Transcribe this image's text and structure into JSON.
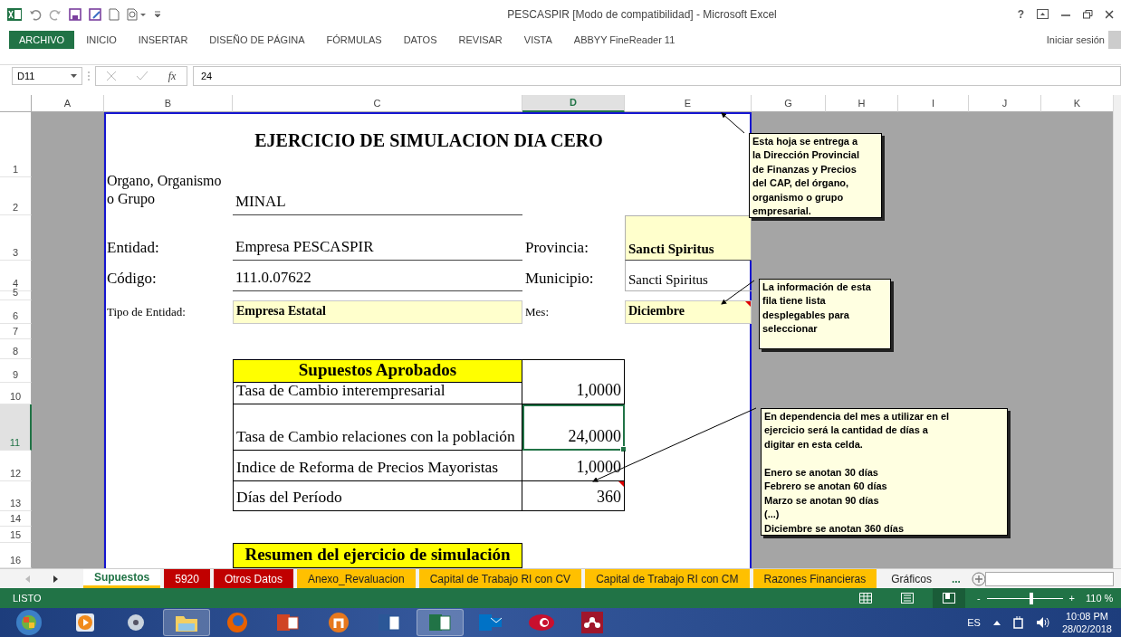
{
  "window": {
    "title": "PESCASPIR  [Modo de compatibilidad] - Microsoft Excel",
    "help": "?"
  },
  "ribbon": {
    "tabs": [
      {
        "label": "ARCHIVO",
        "selected": true
      },
      {
        "label": "INICIO",
        "selected": false
      },
      {
        "label": "INSERTAR",
        "selected": false
      },
      {
        "label": "DISEÑO DE PÁGINA",
        "selected": false
      },
      {
        "label": "FÓRMULAS",
        "selected": false
      },
      {
        "label": "DATOS",
        "selected": false
      },
      {
        "label": "REVISAR",
        "selected": false
      },
      {
        "label": "VISTA",
        "selected": false
      },
      {
        "label": "ABBYY FineReader 11",
        "selected": false
      }
    ],
    "sign_in": "Iniciar sesión"
  },
  "formula_bar": {
    "name_box": "D11",
    "function_label": "fx",
    "value": "24"
  },
  "sheet": {
    "columns": [
      {
        "label": "A",
        "selected": false
      },
      {
        "label": "B",
        "selected": false
      },
      {
        "label": "C",
        "selected": false
      },
      {
        "label": "D",
        "selected": true
      },
      {
        "label": "E",
        "selected": false
      },
      {
        "label": "G",
        "selected": false
      },
      {
        "label": "H",
        "selected": false
      },
      {
        "label": "I",
        "selected": false
      },
      {
        "label": "J",
        "selected": false
      },
      {
        "label": "K",
        "selected": false
      }
    ],
    "rows": [
      {
        "number": "1",
        "selected": false,
        "cells": [
          {
            "kind": "blank"
          },
          {
            "kind": "title",
            "text": "EJERCICIO DE SIMULACION DIA CERO"
          }
        ]
      },
      {
        "number": "2",
        "selected": false,
        "cells": [
          {
            "kind": "stacked-label",
            "text": "Organo, Organismo o Grupo"
          },
          {
            "kind": "underlined",
            "text": "MINAL"
          }
        ]
      },
      {
        "number": "3",
        "selected": false,
        "cells": [
          {
            "kind": "label",
            "text": "Entidad:"
          },
          {
            "kind": "underlined",
            "text": "Empresa PESCASPIR"
          },
          {
            "kind": "label",
            "text": "Provincia:"
          },
          {
            "kind": "highlight",
            "text": "Sancti Spiritus"
          }
        ]
      },
      {
        "number": "4",
        "selected": false,
        "cells": [
          {
            "kind": "label",
            "text": "Código:"
          },
          {
            "kind": "underlined",
            "text": "111.0.07622"
          },
          {
            "kind": "label",
            "text": "Municipio:"
          },
          {
            "kind": "boxed",
            "text": "Sancti Spiritus"
          }
        ]
      },
      {
        "number": "5",
        "selected": false,
        "cells": []
      },
      {
        "number": "6",
        "selected": false,
        "cells": [
          {
            "kind": "small-label",
            "text": "Tipo de Entidad:"
          },
          {
            "kind": "input",
            "text": "Empresa Estatal"
          },
          {
            "kind": "small-label",
            "text": "Mes:"
          },
          {
            "kind": "input",
            "text": "Diciembre",
            "comment": true
          }
        ]
      },
      {
        "number": "7",
        "selected": false,
        "cells": []
      },
      {
        "number": "8",
        "selected": false,
        "cells": []
      },
      {
        "number": "9",
        "selected": false,
        "cells": [
          {
            "kind": "blank"
          },
          {
            "kind": "header",
            "text": "Supuestos Aprobados"
          },
          {
            "kind": "table-blank"
          }
        ]
      },
      {
        "number": "10",
        "selected": false,
        "cells": [
          {
            "kind": "blank"
          },
          {
            "kind": "table-label",
            "text": "Tasa de Cambio interempresarial"
          },
          {
            "kind": "table-number",
            "text": "1,0000"
          }
        ]
      },
      {
        "number": "11",
        "selected": true,
        "cells": [
          {
            "kind": "blank"
          },
          {
            "kind": "table-label",
            "text": "Tasa de Cambio relaciones con la población"
          },
          {
            "kind": "table-number",
            "text": "24,0000"
          }
        ]
      },
      {
        "number": "12",
        "selected": false,
        "cells": [
          {
            "kind": "blank"
          },
          {
            "kind": "table-label",
            "text": "Indice de Reforma de Precios Mayoristas"
          },
          {
            "kind": "table-number",
            "text": "1,0000"
          }
        ]
      },
      {
        "number": "13",
        "selected": false,
        "cells": [
          {
            "kind": "blank"
          },
          {
            "kind": "table-label",
            "text": "Días del Período"
          },
          {
            "kind": "table-number",
            "text": "360",
            "comment": true
          }
        ]
      },
      {
        "number": "14",
        "selected": false,
        "cells": []
      },
      {
        "number": "15",
        "selected": false,
        "cells": []
      },
      {
        "number": "16",
        "selected": false,
        "cells": [
          {
            "kind": "blank"
          },
          {
            "kind": "header",
            "text": "Resumen del ejercicio de simulación"
          }
        ]
      }
    ],
    "notes": [
      {
        "text": "Esta hoja se entrega a\nla Dirección Provincial\nde Finanzas y Precios\ndel CAP,  del órgano,\norganismo o grupo\nempresarial."
      },
      {
        "text": "La información de esta\nfila tiene lista\ndesplegables para\nseleccionar"
      },
      {
        "text": "En dependencia del mes a utilizar en el\nejercicio será la cantidad de días a\ndigitar en esta celda.\n\nEnero se anotan 30 días\nFebrero se anotan 60 días\nMarzo se anotan 90 días\n(...)\nDiciembre se anotan 360 días"
      }
    ]
  },
  "sheet_tabs": [
    {
      "label": "Supuestos",
      "selected": true,
      "color": "#ffffff"
    },
    {
      "label": "5920",
      "selected": false,
      "color": "#c00000"
    },
    {
      "label": "Otros Datos",
      "selected": false,
      "color": "#c00000"
    },
    {
      "label": "Anexo_Revaluacion",
      "selected": false,
      "color": "#ffc000"
    },
    {
      "label": "Capital de Trabajo RI con CV",
      "selected": false,
      "color": "#ffc000"
    },
    {
      "label": "Capital de Trabajo RI con CM",
      "selected": false,
      "color": "#ffc000"
    },
    {
      "label": "Razones Financieras",
      "selected": false,
      "color": "#ffc000"
    },
    {
      "label": "Gráficos",
      "selected": false,
      "color": "#f3f3f3"
    }
  ],
  "more_tabs": "...",
  "status_bar": {
    "text": "LISTO",
    "views": [
      {
        "kind": "normal",
        "selected": false
      },
      {
        "kind": "layout",
        "selected": false
      },
      {
        "kind": "break",
        "selected": true
      }
    ],
    "zoom": {
      "level": 0.59,
      "reading": "110 %",
      "minus": "-",
      "plus": "+"
    }
  },
  "taskbar": {
    "apps": [
      {
        "kind": "media",
        "active": false
      },
      {
        "kind": "disc",
        "active": false
      },
      {
        "kind": "folder",
        "active": true
      },
      {
        "kind": "globe",
        "active": false
      },
      {
        "kind": "slides",
        "active": false
      },
      {
        "kind": "ring",
        "active": false
      },
      {
        "kind": "doc",
        "active": false
      },
      {
        "kind": "sheet",
        "active": true
      },
      {
        "kind": "mail",
        "active": false
      },
      {
        "kind": "eye",
        "active": false
      },
      {
        "kind": "network",
        "active": false
      }
    ],
    "language": "ES",
    "time": "10:08 PM",
    "date": "28/02/2018"
  }
}
